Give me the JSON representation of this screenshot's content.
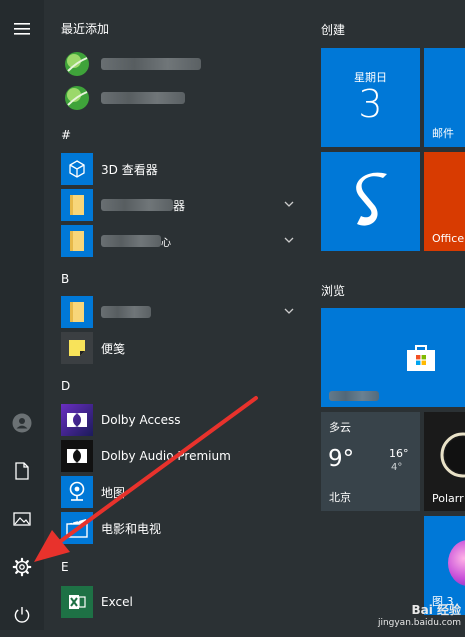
{
  "left_rail": {
    "menu_icon": "hamburger-icon",
    "bottom_icons": [
      "user-icon",
      "document-icon",
      "picture-icon",
      "gear-icon",
      "power-icon"
    ]
  },
  "app_list": {
    "recent_header": "最近添加",
    "groups": [
      {
        "letter": "#"
      },
      {
        "letter": "B"
      },
      {
        "letter": "D"
      },
      {
        "letter": "E"
      }
    ],
    "apps": {
      "viewer_3d": "3D 查看器",
      "folder_1_suffix": "器",
      "folder_2_suffix": "心",
      "sticky_notes": "便笺",
      "dolby_access": "Dolby Access",
      "dolby_audio": "Dolby Audio Premium",
      "maps": "地图",
      "movies": "电影和电视",
      "excel": "Excel"
    }
  },
  "tiles": {
    "create_header": "创建",
    "browse_header": "浏览",
    "calendar": {
      "weekday": "星期日",
      "day": "3"
    },
    "mail": "邮件",
    "office": "Office",
    "weather": {
      "condition": "多云",
      "temp": "9°",
      "high": "16°",
      "low": "4°",
      "city": "北京"
    },
    "polarr": "Polarr",
    "photos": "图 3"
  },
  "watermark": {
    "line1": "Bai 经验",
    "line2": "jingyan.baidu.com"
  },
  "colors": {
    "tile_blue": "#0078d7",
    "office_red": "#d83b01",
    "arrow_red": "#e8322c"
  }
}
